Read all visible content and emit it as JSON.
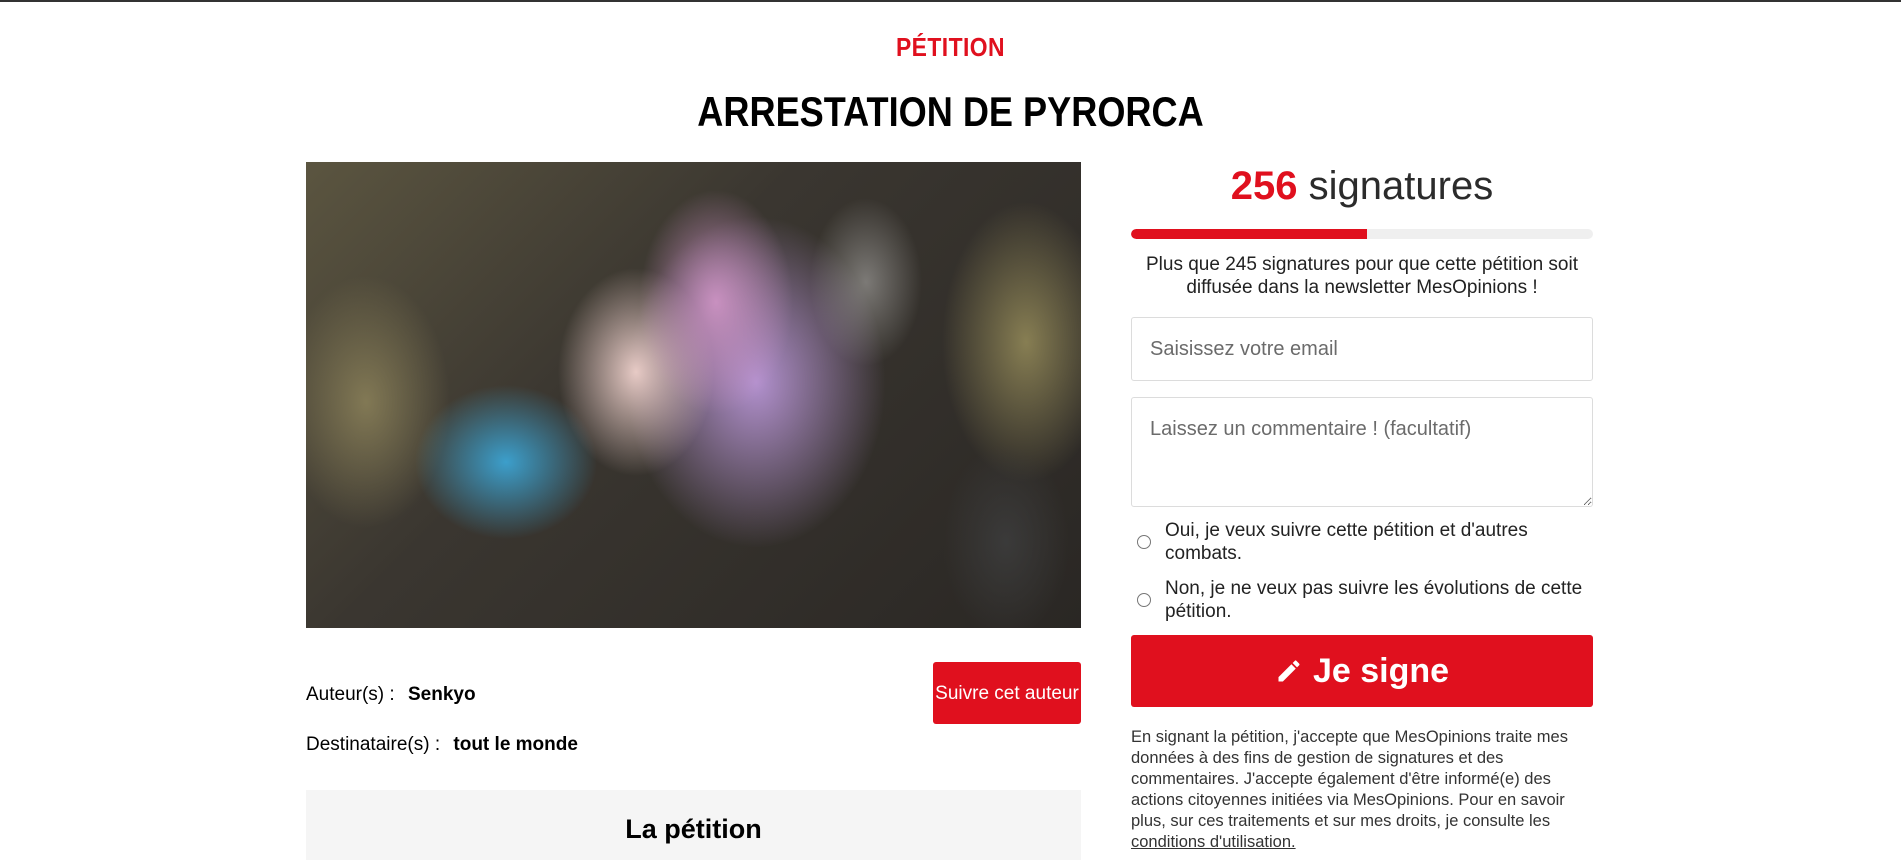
{
  "header": {
    "kicker": "PÉTITION",
    "title": "ARRESTATION DE PYRORCA"
  },
  "petition": {
    "image_alt": "Photo de la pétition",
    "author_key": "Auteur(s) :",
    "author_value": "Senkyo",
    "recipient_key": "Destinataire(s) :",
    "recipient_value": "tout le monde",
    "follow_button": "Suivre cet auteur",
    "section_title": "La pétition"
  },
  "sign": {
    "count": "256",
    "count_label": "signatures",
    "progress_fraction": 0.51,
    "goal_text": "Plus que 245 signatures pour que cette pétition soit diffusée dans la newsletter MesOpinions !",
    "email_placeholder": "Saisissez votre email",
    "comment_placeholder": "Laissez un commentaire ! (facultatif)",
    "opt_in_yes": "Oui, je veux suivre cette pétition et d'autres combats.",
    "opt_in_no": "Non, je ne veux pas suivre les évolutions de cette pétition.",
    "button_label": "Je signe",
    "legal_text": "En signant la pétition, j'accepte que MesOpinions traite mes données à des fins de gestion de signatures et des commentaires. J'accepte également d'être informé(e) des actions citoyennes initiées via MesOpinions. Pour en savoir plus, sur ces traitements et sur mes droits, je consulte les",
    "legal_link": "conditions d'utilisation."
  },
  "colors": {
    "accent": "#e0101e",
    "panel": "#f5f5f5"
  }
}
